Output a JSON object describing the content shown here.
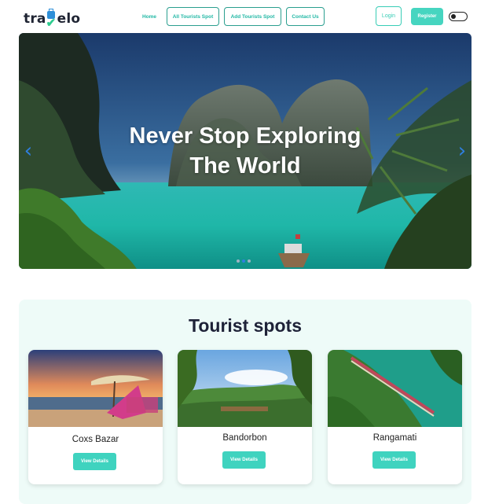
{
  "brand": {
    "logo_left": "tra",
    "logo_right": "elo"
  },
  "nav": {
    "home": "Home",
    "all_spots": "All Tourists Spot",
    "add_spot": "Add Tourists Spot",
    "contact": "Contact Us",
    "login": "Login",
    "register": "Register"
  },
  "hero": {
    "title_line1": "Never Stop Exploring",
    "title_line2": "The World",
    "prev_arrow": "‹",
    "next_arrow": "›",
    "slide_count": 3,
    "active_slide": 2
  },
  "spots": {
    "title": "Tourist spots",
    "cards": [
      {
        "name": "Coxs Bazar",
        "button": "View Details"
      },
      {
        "name": "Bandorbon",
        "button": "View Details"
      },
      {
        "name": "Rangamati",
        "button": "View Details"
      }
    ]
  },
  "colors": {
    "accent": "#46d5c0",
    "nav_text": "#22b8a5",
    "section_bg": "#eefbf8",
    "heading": "#1e2238"
  },
  "icons": {
    "logo": "travel-bag-check-icon",
    "theme_toggle": "toggle-switch-icon",
    "prev": "chevron-left-icon",
    "next": "chevron-right-icon"
  }
}
